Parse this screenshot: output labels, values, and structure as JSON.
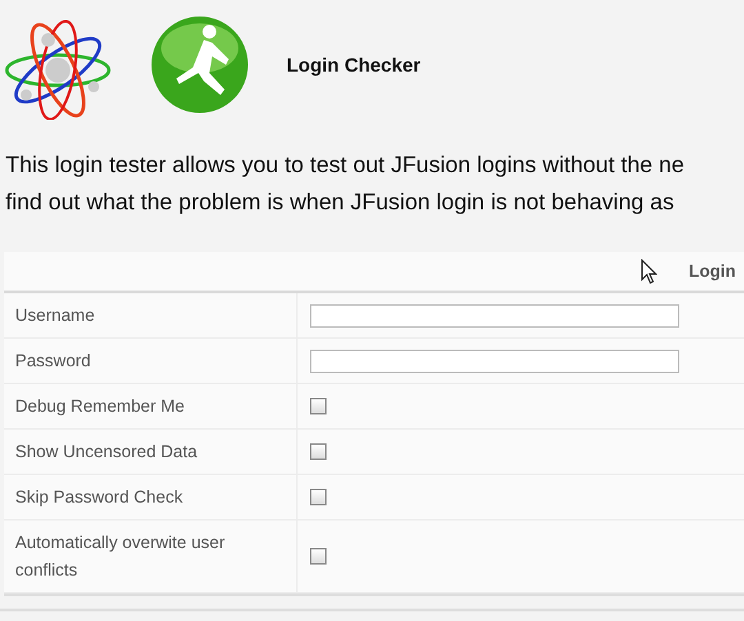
{
  "header": {
    "title": "Login Checker"
  },
  "intro": [
    "This login tester allows you to test out JFusion logins without the ne",
    "find out what the problem is when JFusion login is not behaving as"
  ],
  "table": {
    "heading": "Login",
    "rows": [
      {
        "label": "Username",
        "kind": "text"
      },
      {
        "label": "Password",
        "kind": "text"
      },
      {
        "label": "Debug Remember Me",
        "kind": "checkbox",
        "checked": false
      },
      {
        "label": "Show Uncensored Data",
        "kind": "checkbox",
        "checked": false
      },
      {
        "label": "Skip Password Check",
        "kind": "checkbox",
        "checked": false
      },
      {
        "label": "Automatically overwite user conflicts",
        "kind": "checkbox",
        "checked": false
      }
    ]
  }
}
